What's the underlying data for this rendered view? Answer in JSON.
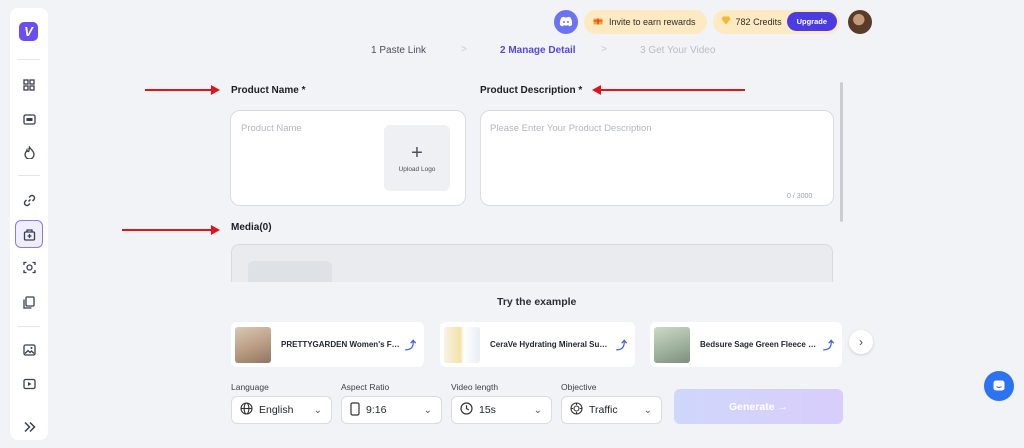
{
  "app": {
    "logo_letter": "V"
  },
  "header": {
    "invite_label": "Invite to earn rewards",
    "credits_label": "782 Credits",
    "upgrade_label": "Upgrade"
  },
  "steps": [
    {
      "label": "1 Paste Link",
      "state": "done"
    },
    {
      "label": "2 Manage Detail",
      "state": "active"
    },
    {
      "label": "3 Get Your Video",
      "state": "upcoming"
    }
  ],
  "step_separator": ">",
  "form": {
    "product_name_label": "Product Name *",
    "product_name_placeholder": "Product Name",
    "upload_logo_label": "Upload Logo",
    "product_description_label": "Product Description *",
    "product_description_placeholder": "Please Enter Your Product Description",
    "description_counter": "0 / 3000",
    "media_label": "Media(0)"
  },
  "examples": {
    "title": "Try the example",
    "items": [
      {
        "title": "PRETTYGARDEN Women's Fall Sweater"
      },
      {
        "title": "CeraVe Hydrating Mineral Sunscreen"
      },
      {
        "title": "Bedsure Sage Green Fleece Blanket"
      }
    ]
  },
  "options": {
    "language": {
      "label": "Language",
      "value": "English"
    },
    "aspect_ratio": {
      "label": "Aspect Ratio",
      "value": "9:16"
    },
    "video_length": {
      "label": "Video length",
      "value": "15s"
    },
    "objective": {
      "label": "Objective",
      "value": "Traffic"
    }
  },
  "generate_label": "Generate →",
  "colors": {
    "accent": "#5546e8",
    "annotation_arrow": "#e0141a",
    "upgrade_button": "#4a3ce0",
    "chat_button": "#2c73f2"
  }
}
